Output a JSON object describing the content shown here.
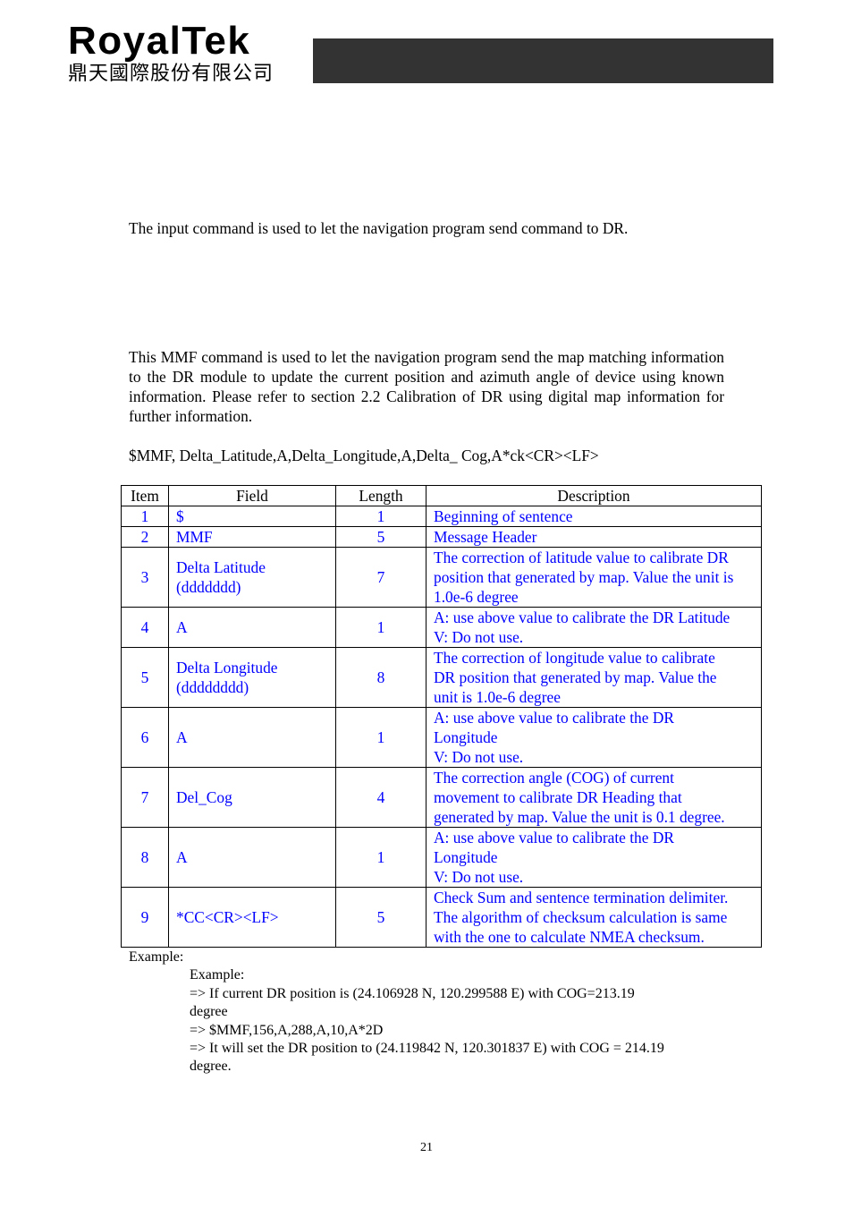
{
  "header": {
    "logo_en": "RoyalTek",
    "logo_zh": "鼎天國際股份有限公司",
    "bar_color": "#333333"
  },
  "intro": "The input command is used to let the navigation program send command to DR.",
  "mmf_description": "This MMF command is used to let the navigation program send the map matching information to the DR module to update the current position and azimuth angle of device using known information. Please refer to section 2.2 Calibration of DR using digital map information for further information.",
  "syntax": "$MMF, Delta_Latitude,A,Delta_Longitude,A,Delta_ Cog,A*ck<CR><LF>",
  "table": {
    "headers": [
      "Item",
      "Field",
      "Length",
      "Description"
    ],
    "text_color": "#0000ff",
    "rows": [
      {
        "item": "1",
        "field": [
          "$"
        ],
        "length": "1",
        "description": [
          "Beginning of sentence"
        ]
      },
      {
        "item": "2",
        "field": [
          "MMF"
        ],
        "length": "5",
        "description": [
          "Message Header"
        ]
      },
      {
        "item": "3",
        "field": [
          "Delta Latitude",
          "(ddddddd)"
        ],
        "length": "7",
        "description": [
          "The correction of latitude value to calibrate DR",
          "position that generated by map. Value the unit is",
          "1.0e-6 degree"
        ]
      },
      {
        "item": "4",
        "field": [
          "A"
        ],
        "length": "1",
        "description": [
          "A: use above value to calibrate the DR Latitude",
          "V: Do not use."
        ]
      },
      {
        "item": "5",
        "field": [
          "Delta Longitude",
          "(dddddddd)"
        ],
        "length": "8",
        "description": [
          "The correction of longitude value to calibrate",
          "DR position that generated by map. Value the",
          "unit is 1.0e-6 degree"
        ]
      },
      {
        "item": "6",
        "field": [
          "A"
        ],
        "length": "1",
        "description": [
          "A: use above value to calibrate the DR",
          "Longitude",
          "V: Do not use."
        ]
      },
      {
        "item": "7",
        "field": [
          "Del_Cog"
        ],
        "length": "4",
        "description": [
          "The correction angle (COG) of current",
          "movement to calibrate DR Heading that",
          "generated by map. Value the unit is 0.1 degree."
        ]
      },
      {
        "item": "8",
        "field": [
          "A"
        ],
        "length": "1",
        "description": [
          "A: use above value to calibrate the DR",
          "Longitude",
          "V: Do not use."
        ]
      },
      {
        "item": "9",
        "field": [
          "*CC<CR><LF>"
        ],
        "length": "5",
        "description": [
          "Check Sum and sentence termination delimiter.",
          "The algorithm of checksum calculation is same",
          "with the one to calculate NMEA checksum."
        ]
      }
    ]
  },
  "example": {
    "label": "Example:",
    "lines": [
      "Example:",
      "=> If current DR position is (24.106928 N, 120.299588 E) with COG=213.19",
      "degree",
      "=> $MMF,156,A,288,A,10,A*2D",
      "=> It will set the DR position to (24.119842 N, 120.301837 E) with COG = 214.19",
      "degree."
    ]
  },
  "page_number": "21"
}
